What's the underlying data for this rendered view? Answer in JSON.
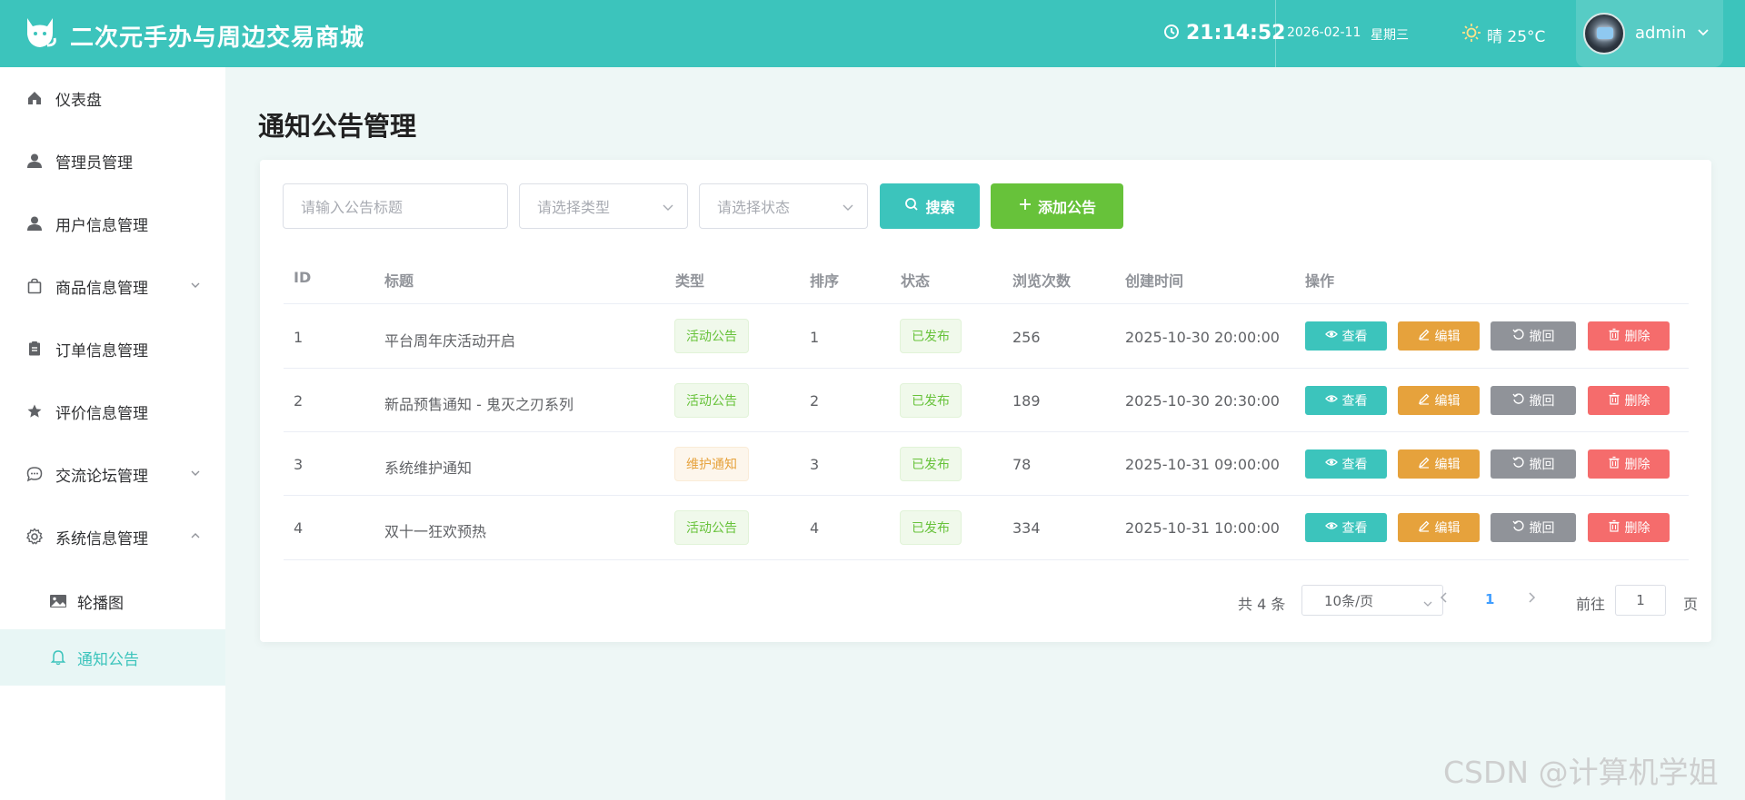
{
  "header": {
    "app_title": "二次元手办与周边交易商城",
    "time": "21:14:52",
    "date": "2026-02-11",
    "weekday": "星期三",
    "weather": "晴 25°C",
    "username": "admin",
    "bg_color": "#3cc4bc"
  },
  "sidebar": {
    "items": [
      {
        "label": "仪表盘",
        "icon": "home-icon"
      },
      {
        "label": "管理员管理",
        "icon": "user-icon"
      },
      {
        "label": "用户信息管理",
        "icon": "user-icon"
      },
      {
        "label": "商品信息管理",
        "icon": "bag-icon",
        "expanded": false
      },
      {
        "label": "订单信息管理",
        "icon": "clipboard-icon"
      },
      {
        "label": "评价信息管理",
        "icon": "star-icon"
      },
      {
        "label": "交流论坛管理",
        "icon": "chat-icon",
        "expanded": false
      },
      {
        "label": "系统信息管理",
        "icon": "gear-icon",
        "expanded": true
      }
    ],
    "subitems": [
      {
        "label": "轮播图",
        "icon": "picture-icon"
      },
      {
        "label": "通知公告",
        "icon": "bell-icon",
        "active": true
      }
    ]
  },
  "page": {
    "title": "通知公告管理"
  },
  "filters": {
    "title_placeholder": "请输入公告标题",
    "type_placeholder": "请选择类型",
    "status_placeholder": "请选择状态",
    "search_label": "搜索",
    "add_label": "添加公告"
  },
  "table": {
    "headers": [
      "ID",
      "标题",
      "类型",
      "排序",
      "状态",
      "浏览次数",
      "创建时间",
      "操作"
    ],
    "actions": {
      "view": "查看",
      "edit": "编辑",
      "revoke": "撤回",
      "delete": "删除"
    },
    "rows": [
      {
        "id": "1",
        "title": "平台周年庆活动开启",
        "type": "活动公告",
        "type_color": "green",
        "sort": "1",
        "status": "已发布",
        "views": "256",
        "created": "2025-10-30 20:00:00"
      },
      {
        "id": "2",
        "title": "新品预售通知 - 鬼灭之刃系列",
        "type": "活动公告",
        "type_color": "green",
        "sort": "2",
        "status": "已发布",
        "views": "189",
        "created": "2025-10-30 20:30:00"
      },
      {
        "id": "3",
        "title": "系统维护通知",
        "type": "维护通知",
        "type_color": "orange",
        "sort": "3",
        "status": "已发布",
        "views": "78",
        "created": "2025-10-31 09:00:00"
      },
      {
        "id": "4",
        "title": "双十一狂欢预热",
        "type": "活动公告",
        "type_color": "green",
        "sort": "4",
        "status": "已发布",
        "views": "334",
        "created": "2025-10-31 10:00:00"
      }
    ]
  },
  "pagination": {
    "total": "共 4 条",
    "page_size": "10条/页",
    "current_page": "1",
    "goto_label": "前往",
    "goto_value": "1",
    "page_suffix": "页"
  },
  "watermark": "CSDN @计算机学姐"
}
